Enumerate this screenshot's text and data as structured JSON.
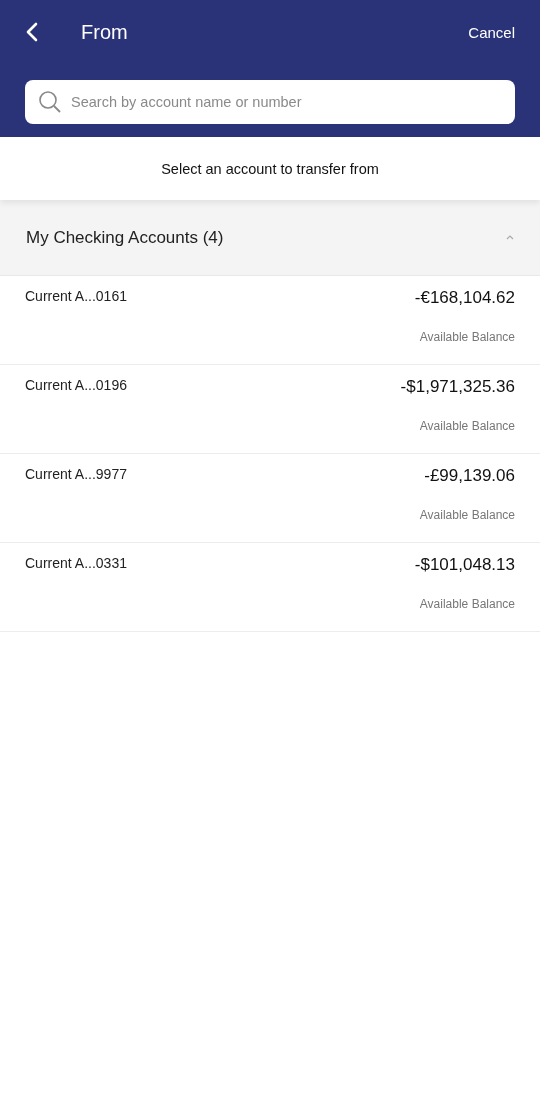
{
  "header": {
    "title": "From",
    "cancel": "Cancel"
  },
  "search": {
    "placeholder": "Search by account name or number"
  },
  "instruction": "Select an account to transfer from",
  "group": {
    "title": "My Checking Accounts (4)",
    "expanded": true,
    "accounts": [
      {
        "name": "Current A...0161",
        "balance": "-€168,104.62",
        "balance_label": "Available Balance"
      },
      {
        "name": "Current A...0196",
        "balance": "-$1,971,325.36",
        "balance_label": "Available Balance"
      },
      {
        "name": "Current A...9977",
        "balance": "-£99,139.06",
        "balance_label": "Available Balance"
      },
      {
        "name": "Current A...0331",
        "balance": "-$101,048.13",
        "balance_label": "Available Balance"
      }
    ]
  }
}
